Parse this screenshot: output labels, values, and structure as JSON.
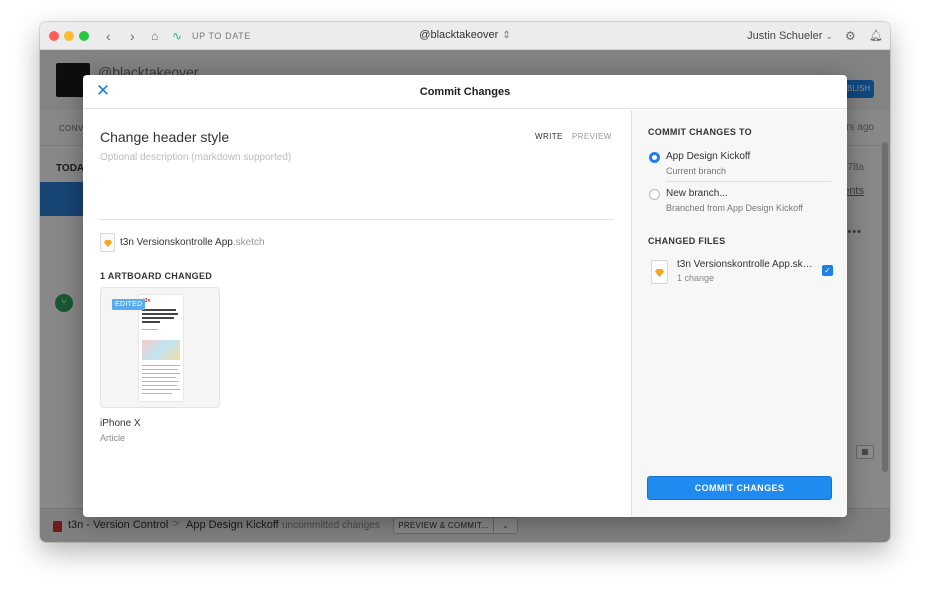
{
  "window": {
    "status": "UP TO DATE",
    "document_title": "@blacktakeover",
    "user_name": "Justin Schueler"
  },
  "background": {
    "handle": "@blacktakeover",
    "primary_button": "PUBLISH",
    "tab": "CONVERSATIONS",
    "time_ago": "2 hours ago",
    "section": "TODAY",
    "hash": "78a",
    "link": "2 comments",
    "statusbar": {
      "project": "t3n - Version Control",
      "separator": ">",
      "branch": "App Design Kickoff",
      "uncommitted": "uncommitted changes",
      "preview_button": "PREVIEW & COMMIT..."
    }
  },
  "modal": {
    "title": "Commit Changes",
    "commit_title": "Change header style",
    "description_placeholder": "Optional description (markdown supported)",
    "write_tab": "WRITE",
    "preview_tab": "PREVIEW",
    "file": {
      "name": "t3n Versionskontrolle App",
      "ext": ".sketch"
    },
    "artboards_changed": "1 ARTBOARD CHANGED",
    "artboard": {
      "badge": "EDITED",
      "name": "iPhone X",
      "subtitle": "Article",
      "thumb_logo": "t3n"
    },
    "commit_to_heading": "COMMIT CHANGES TO",
    "options": [
      {
        "label": "App Design Kickoff",
        "sub": "Current branch",
        "selected": true
      },
      {
        "label": "New branch...",
        "sub": "Branched from App Design Kickoff",
        "selected": false
      }
    ],
    "changed_files_heading": "CHANGED FILES",
    "changed_file": {
      "name": "t3n Versionskontrolle App.sketch",
      "sub": "1 change",
      "checked": true
    },
    "commit_button": "COMMIT CHANGES"
  },
  "colors": {
    "accent": "#1f80e8",
    "badge": "#5aaaf0",
    "sketch": "#f5a623"
  }
}
